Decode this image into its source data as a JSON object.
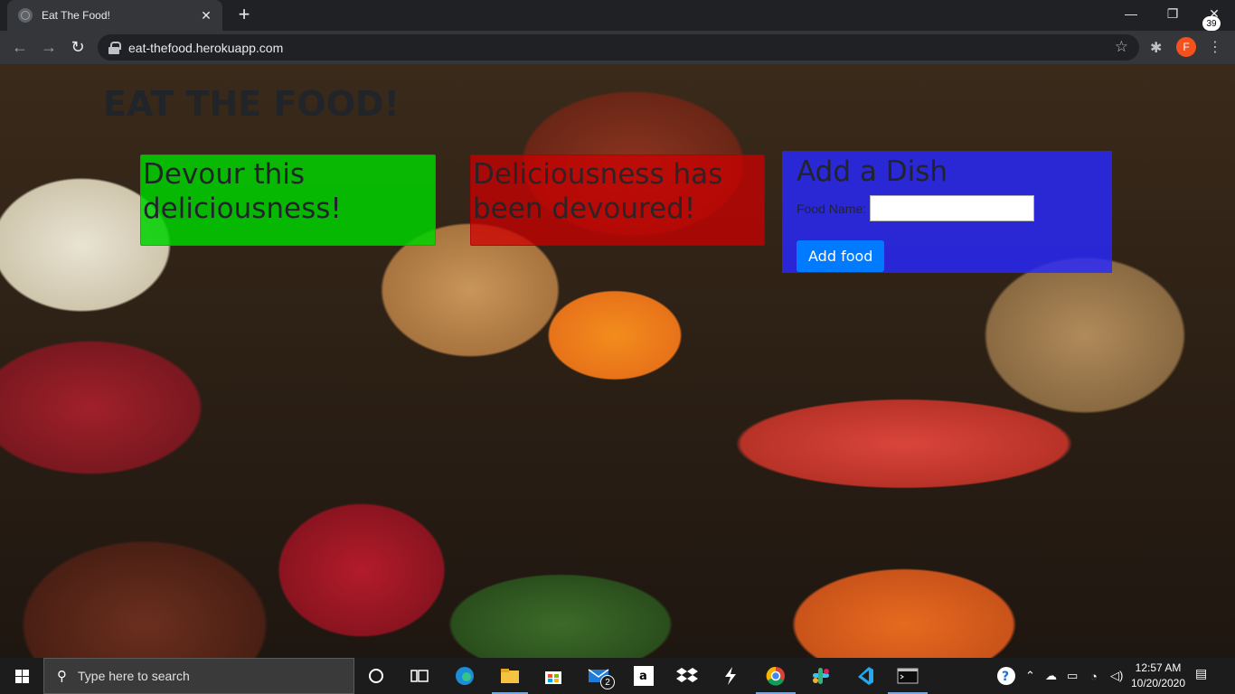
{
  "browser": {
    "tab_title": "Eat The Food!",
    "tab_close": "✕",
    "new_tab": "+",
    "url": "eat-thefood.herokuapp.com",
    "profile_initial": "F",
    "window": {
      "minimize": "—",
      "maximize": "❐",
      "close": "✕"
    },
    "nav": {
      "back": "←",
      "forward": "→",
      "reload": "↻"
    },
    "star": "☆",
    "extensions": "✱",
    "menu": "⋮"
  },
  "page": {
    "title": "EAT THE FOOD!",
    "devour_card": {
      "heading": "Devour this deliciousness!"
    },
    "devoured_card": {
      "heading": "Deliciousness has been devoured!"
    },
    "add_card": {
      "heading": "Add a Dish",
      "food_label": "Food Name:",
      "food_value": "",
      "button_label": "Add food"
    },
    "colors": {
      "devour": "#00d200",
      "devoured": "#cd0000",
      "add": "#2828ff",
      "button": "#007bff"
    }
  },
  "taskbar": {
    "search_placeholder": "Type here to search",
    "mail_badge": "2",
    "time": "12:57 AM",
    "date": "10/20/2020",
    "notifications": "39",
    "icons": [
      "cortana-icon",
      "task-view-icon",
      "edge-icon",
      "file-explorer-icon",
      "store-icon",
      "mail-icon",
      "amazon-icon",
      "dropbox-icon",
      "git-icon",
      "chrome-icon",
      "slack-icon",
      "vscode-icon",
      "terminal-icon"
    ]
  }
}
